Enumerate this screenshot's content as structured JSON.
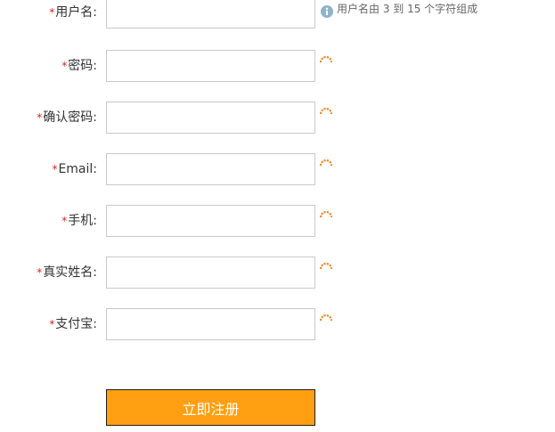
{
  "form": {
    "required_mark": "*",
    "fields": [
      {
        "label": "用户名:",
        "value": "",
        "hint": "用户名由 3 到 15 个字符组成"
      },
      {
        "label": "密码:",
        "value": ""
      },
      {
        "label": "确认密码:",
        "value": ""
      },
      {
        "label": "Email:",
        "value": ""
      },
      {
        "label": "手机:",
        "value": ""
      },
      {
        "label": "真实姓名:",
        "value": ""
      },
      {
        "label": "支付宝:",
        "value": ""
      }
    ],
    "submit_label": "立即注册"
  },
  "colors": {
    "required": "#e02020",
    "accent": "#ff9f11",
    "hint_icon": "#8fb3c8",
    "loader": "#f28a2b"
  }
}
